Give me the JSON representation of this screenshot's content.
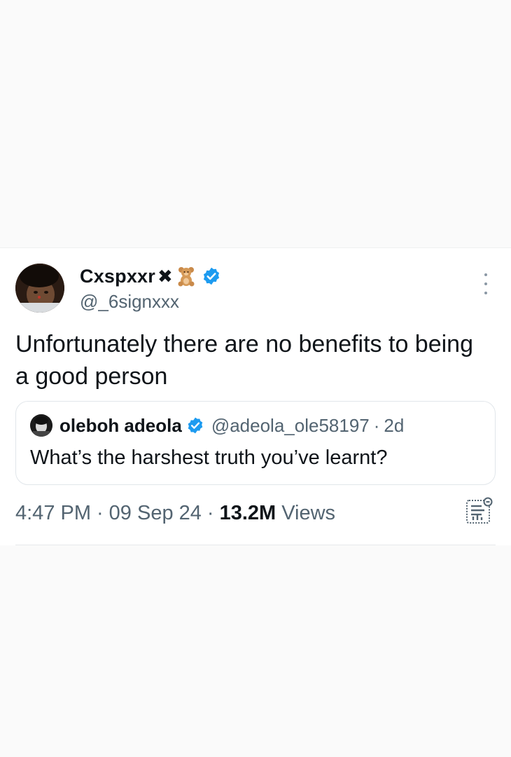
{
  "tweet": {
    "author": {
      "display_name": "Cxspxxr",
      "name_emojis": [
        "✖",
        "🧸"
      ],
      "handle": "@_6signxxx",
      "verified": true,
      "avatar_icon": "profile-photo-avatar"
    },
    "text": "Unfortunately there are no benefits to being a good person",
    "quoted": {
      "author_name": "oleboh adeola",
      "handle": "@adeola_ole58197",
      "separator": "·",
      "time": "2d",
      "text": "What’s the harshest truth you’ve learnt?",
      "verified": true
    },
    "meta": {
      "time": "4:47 PM",
      "separator_1": "·",
      "date": "09 Sep 24",
      "separator_2": "·",
      "views_count": "13.2M",
      "views_label": "Views"
    },
    "icons": {
      "more": "more-options-icon",
      "analytics": "analytics-icon",
      "verified": "verified-badge-icon"
    },
    "colors": {
      "verified_blue": "#1d9bf0",
      "secondary_text": "#536471",
      "primary_text": "#0f1419",
      "background": "#fafafa"
    }
  }
}
